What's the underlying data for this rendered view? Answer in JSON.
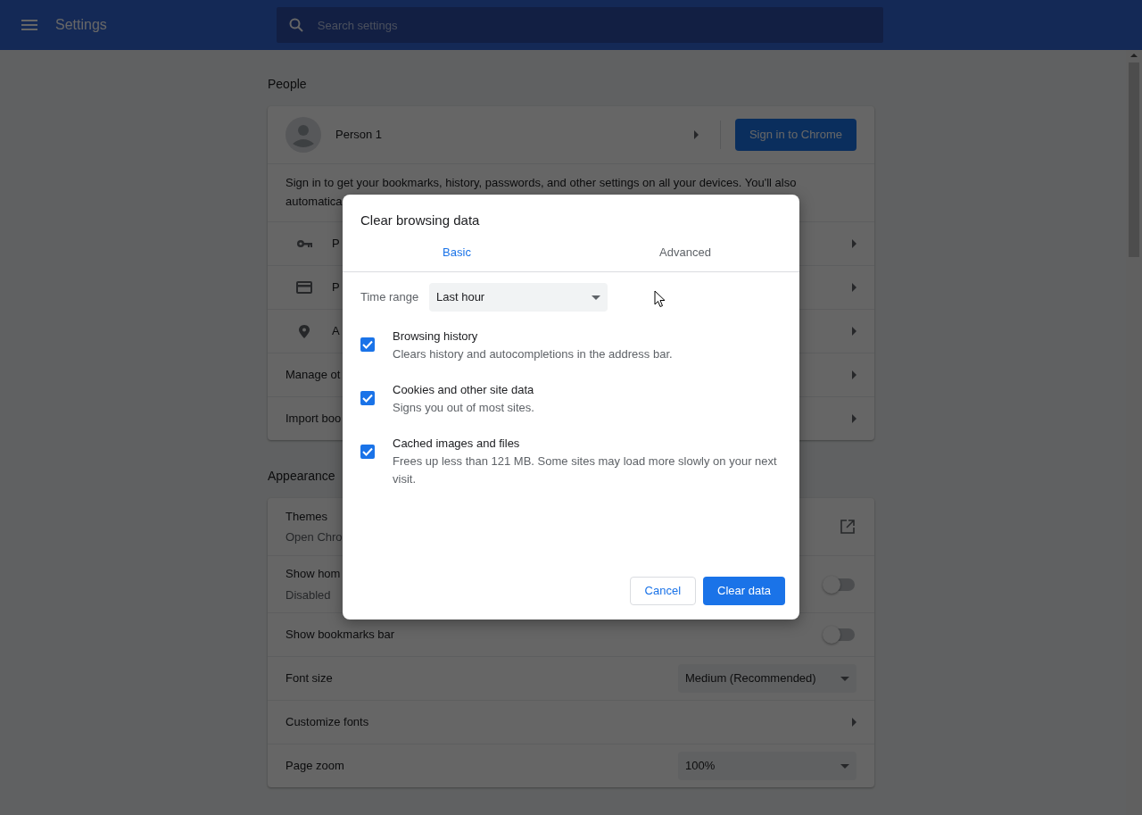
{
  "header": {
    "title": "Settings",
    "search": {
      "placeholder": "Search settings"
    }
  },
  "people": {
    "heading": "People",
    "profile": {
      "name": "Person 1",
      "button": "Sign in to Chrome"
    },
    "sign_in_text": [
      "Sign in to get your bookmarks, history, passwords, and other settings on all your devices. You'll also",
      "automatica"
    ],
    "rows": [
      {
        "kind": "icon",
        "label": "P"
      },
      {
        "kind": "icon",
        "label": "P"
      },
      {
        "kind": "icon",
        "label": "A"
      },
      {
        "kind": "plain",
        "label": "Manage ot"
      },
      {
        "kind": "plain",
        "label": "Import boo"
      }
    ]
  },
  "appearance": {
    "heading": "Appearance",
    "rows": [
      {
        "kind": "link",
        "label": "Themes",
        "sub": "Open Chro"
      },
      {
        "kind": "toggle",
        "label": "Show hom",
        "sub": "Disabled",
        "on": false
      },
      {
        "kind": "toggle",
        "label": "Show bookmarks bar",
        "on": false
      },
      {
        "kind": "select",
        "label": "Font size",
        "value": "Medium (Recommended)"
      },
      {
        "kind": "arrow",
        "label": "Customize fonts"
      },
      {
        "kind": "select",
        "label": "Page zoom",
        "value": "100%"
      }
    ]
  },
  "dialog": {
    "title": "Clear browsing data",
    "tabs": [
      {
        "label": "Basic",
        "selected": true
      },
      {
        "label": "Advanced",
        "selected": false
      }
    ],
    "time_range": {
      "label": "Time range",
      "value": "Last hour"
    },
    "items": [
      {
        "title": "Browsing history",
        "description": "Clears history and autocompletions in the address bar.",
        "checked": true
      },
      {
        "title": "Cookies and other site data",
        "description": "Signs you out of most sites.",
        "checked": true
      },
      {
        "title": "Cached images and files",
        "description": "Frees up less than 121 MB. Some sites may load more slowly on your next visit.",
        "checked": true
      }
    ],
    "buttons": {
      "cancel": "Cancel",
      "confirm": "Clear data"
    }
  }
}
